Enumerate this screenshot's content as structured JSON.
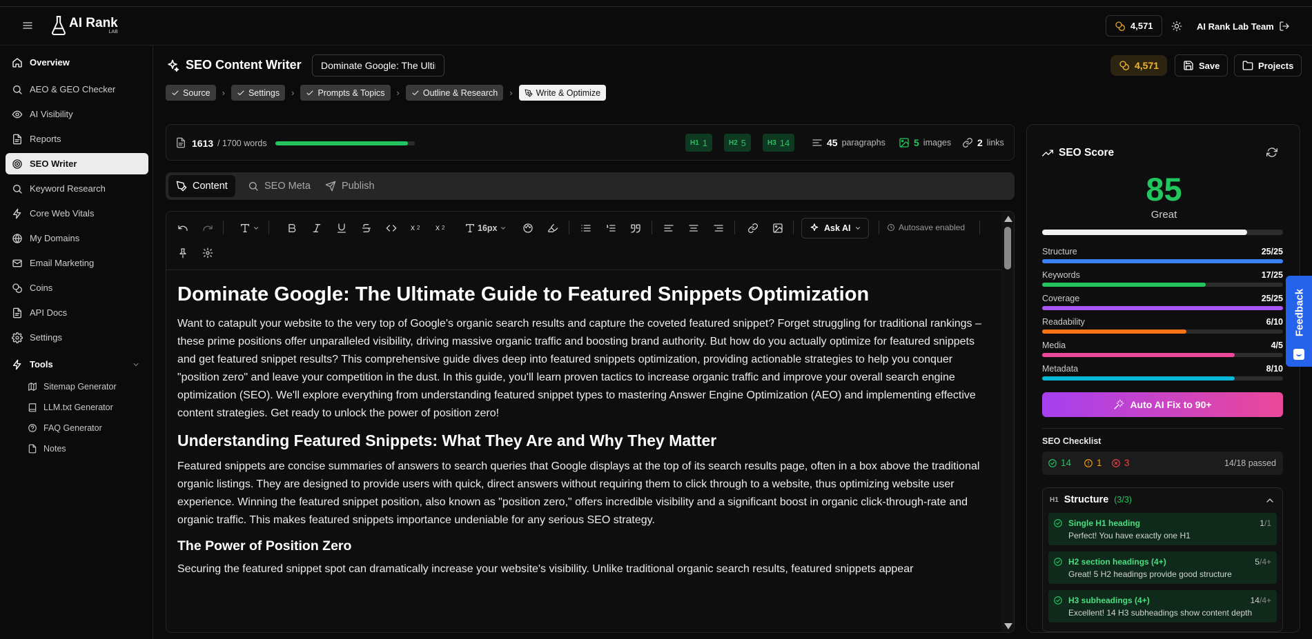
{
  "header": {
    "logo_text": "AI Rank",
    "logo_sub": "LAB",
    "coins": "4,571",
    "team": "AI Rank Lab Team"
  },
  "sidebar": {
    "items": [
      {
        "label": "Overview",
        "icon": "home-icon"
      },
      {
        "label": "AEO & GEO Checker",
        "icon": "search-icon"
      },
      {
        "label": "AI Visibility",
        "icon": "eye-icon"
      },
      {
        "label": "Reports",
        "icon": "file-icon"
      },
      {
        "label": "SEO Writer",
        "icon": "target-icon"
      },
      {
        "label": "Keyword Research",
        "icon": "search-icon"
      },
      {
        "label": "Core Web Vitals",
        "icon": "zap-icon"
      },
      {
        "label": "My Domains",
        "icon": "globe-icon"
      },
      {
        "label": "Email Marketing",
        "icon": "mail-icon"
      },
      {
        "label": "Coins",
        "icon": "coins-icon"
      },
      {
        "label": "API Docs",
        "icon": "file-icon"
      },
      {
        "label": "Settings",
        "icon": "gear-icon"
      }
    ],
    "tools_label": "Tools",
    "tools": [
      {
        "label": "Sitemap Generator",
        "icon": "map-icon"
      },
      {
        "label": "LLM.txt Generator",
        "icon": "book-icon"
      },
      {
        "label": "FAQ Generator",
        "icon": "help-icon"
      },
      {
        "label": "Notes",
        "icon": "file-icon"
      }
    ]
  },
  "page": {
    "title": "SEO Content Writer",
    "doc_title": "Dominate Google: The Ultimate Guide to Featured Snippets Optimization",
    "coins": "4,571",
    "save_label": "Save",
    "projects_label": "Projects"
  },
  "steps": [
    {
      "label": "Source",
      "done": true
    },
    {
      "label": "Settings",
      "done": true
    },
    {
      "label": "Prompts & Topics",
      "done": true
    },
    {
      "label": "Outline & Research",
      "done": true
    },
    {
      "label": "Write & Optimize",
      "done": false
    }
  ],
  "stats": {
    "words": "1613",
    "words_target": "/ 1700 words",
    "progress": 0.949,
    "h1": "1",
    "h2": "5",
    "h3": "14",
    "paragraphs": "45",
    "paragraphs_label": "paragraphs",
    "images": "5",
    "images_label": "images",
    "links": "2",
    "links_label": "links"
  },
  "tabs": [
    "Content",
    "SEO Meta",
    "Publish"
  ],
  "toolbar": {
    "font_size": "16px",
    "ask_ai": "Ask AI",
    "autosave": "Autosave enabled"
  },
  "content": {
    "h1": "Dominate Google: The Ultimate Guide to Featured Snippets Optimization",
    "p1": "Want to catapult your website to the very top of Google's organic search results and capture the coveted featured snippet? Forget struggling for traditional rankings – these prime positions offer unparalleled visibility, driving massive organic traffic and boosting brand authority. But how do you actually optimize for featured snippets and get featured snippet results? This comprehensive guide dives deep into featured snippets optimization, providing actionable strategies to help you conquer \"position zero\" and leave your competition in the dust. In this guide, you'll learn proven tactics to increase organic traffic and improve your overall search engine optimization (SEO). We'll explore everything from understanding featured snippet types to mastering Answer Engine Optimization (AEO) and implementing effective content strategies. Get ready to unlock the power of position zero!",
    "h2": "Understanding Featured Snippets: What They Are and Why They Matter",
    "p2": "Featured snippets are concise summaries of answers to search queries that Google displays at the top of its search results page, often in a box above the traditional organic listings. They are designed to provide users with quick, direct answers without requiring them to click through to a website, thus optimizing website user experience. Winning the featured snippet position, also known as \"position zero,\" offers incredible visibility and a significant boost in organic click-through-rate and organic traffic. This makes featured snippets importance undeniable for any serious SEO strategy.",
    "h3": "The Power of Position Zero",
    "p3": "Securing the featured snippet spot can dramatically increase your website's visibility. Unlike traditional organic search results, featured snippets appear"
  },
  "seo": {
    "title": "SEO Score",
    "score": "85",
    "score_value": 85,
    "score_label": "Great",
    "metrics": [
      {
        "name": "Structure",
        "value": "25/25",
        "fraction": 1.0,
        "color": "#3b82f6"
      },
      {
        "name": "Keywords",
        "value": "17/25",
        "fraction": 0.68,
        "color": "#22c55e"
      },
      {
        "name": "Coverage",
        "value": "25/25",
        "fraction": 1.0,
        "color": "#a855f7"
      },
      {
        "name": "Readability",
        "value": "6/10",
        "fraction": 0.6,
        "color": "#f97316"
      },
      {
        "name": "Media",
        "value": "4/5",
        "fraction": 0.8,
        "color": "#ec4899"
      },
      {
        "name": "Metadata",
        "value": "8/10",
        "fraction": 0.8,
        "color": "#06b6d4"
      }
    ],
    "autofix_label": "Auto AI Fix to 90+",
    "checklist_title": "SEO Checklist",
    "passed_count": "14",
    "warn_count": "1",
    "fail_count": "3",
    "passed_label": "14/18 passed",
    "group_name": "Structure",
    "group_count": "(3/3)",
    "items": [
      {
        "title": "Single H1 heading",
        "desc": "Perfect! You have exactly one H1",
        "count": "1",
        "target": "/1"
      },
      {
        "title": "H2 section headings (4+)",
        "desc": "Great! 5 H2 headings provide good structure",
        "count": "5",
        "target": "/4+"
      },
      {
        "title": "H3 subheadings (4+)",
        "desc": "Excellent! 14 H3 subheadings show content depth",
        "count": "14",
        "target": "/4+"
      }
    ]
  },
  "feedback_label": "Feedback",
  "colors": {
    "accent_green": "#22c55e",
    "coin_gold": "#f2b62a",
    "feedback_blue": "#2563eb"
  }
}
